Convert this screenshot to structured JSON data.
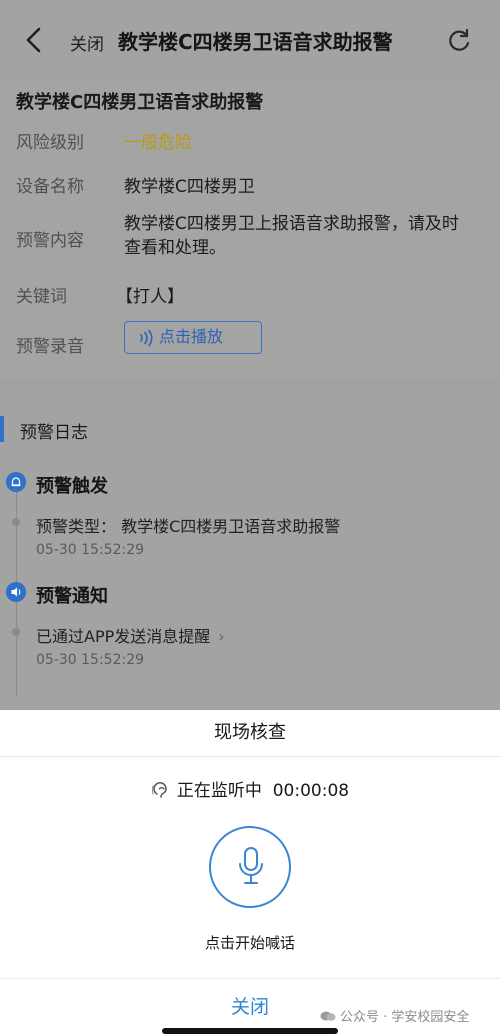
{
  "nav": {
    "close_label": "关闭",
    "title": "教学楼C四楼男卫语音求助报警"
  },
  "detail": {
    "title": "教学楼C四楼男卫语音求助报警",
    "risk_label": "风险级别",
    "risk_value": "一般危险",
    "device_label": "设备名称",
    "device_value": "教学楼C四楼男卫",
    "content_label": "预警内容",
    "content_value": "教学楼C四楼男卫上报语音求助报警，请及时查看和处理。",
    "keyword_label": "关键词",
    "keyword_value": "【打人】",
    "recording_label": "预警录音",
    "play_label": "点击播放"
  },
  "log": {
    "title": "预警日志",
    "steps": [
      {
        "title": "预警触发",
        "icon": "alarm-icon",
        "text": "预警类型：  教学楼C四楼男卫语音求助报警",
        "time": "05-30 15:52:29"
      },
      {
        "title": "预警通知",
        "icon": "speaker-icon",
        "text": "已通过APP发送消息提醒",
        "time": "05-30 15:52:29"
      }
    ]
  },
  "sheet": {
    "title": "现场核查",
    "monitor_label": "正在监听中",
    "monitor_time": "00:00:08",
    "mic_label": "点击开始喊话",
    "close_label": "关闭"
  },
  "watermark": "公众号 · 学安校园安全",
  "colors": {
    "accent": "#2f72c8",
    "risk": "#b89a18",
    "close": "#2d86d6"
  }
}
